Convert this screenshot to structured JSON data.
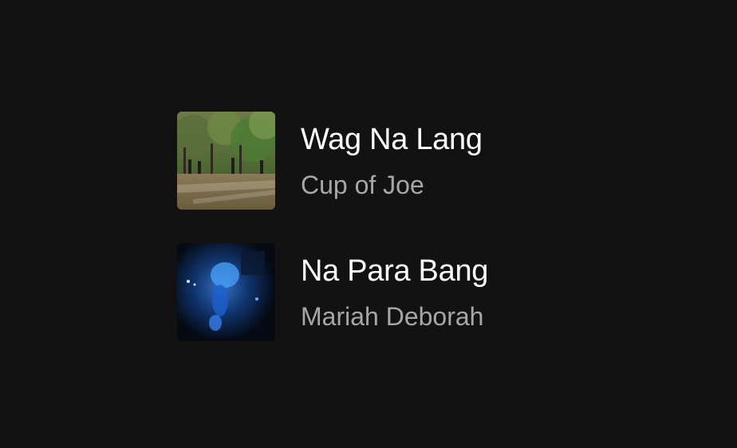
{
  "tracks": [
    {
      "title": "Wag Na Lang",
      "artist": "Cup of Joe",
      "cover_icon": "album-art-park-scene"
    },
    {
      "title": "Na Para Bang",
      "artist": "Mariah Deborah",
      "cover_icon": "album-art-blue-night-figure"
    }
  ],
  "colors": {
    "background": "#121212",
    "title": "#ffffff",
    "subtitle": "#a7a7a7"
  }
}
